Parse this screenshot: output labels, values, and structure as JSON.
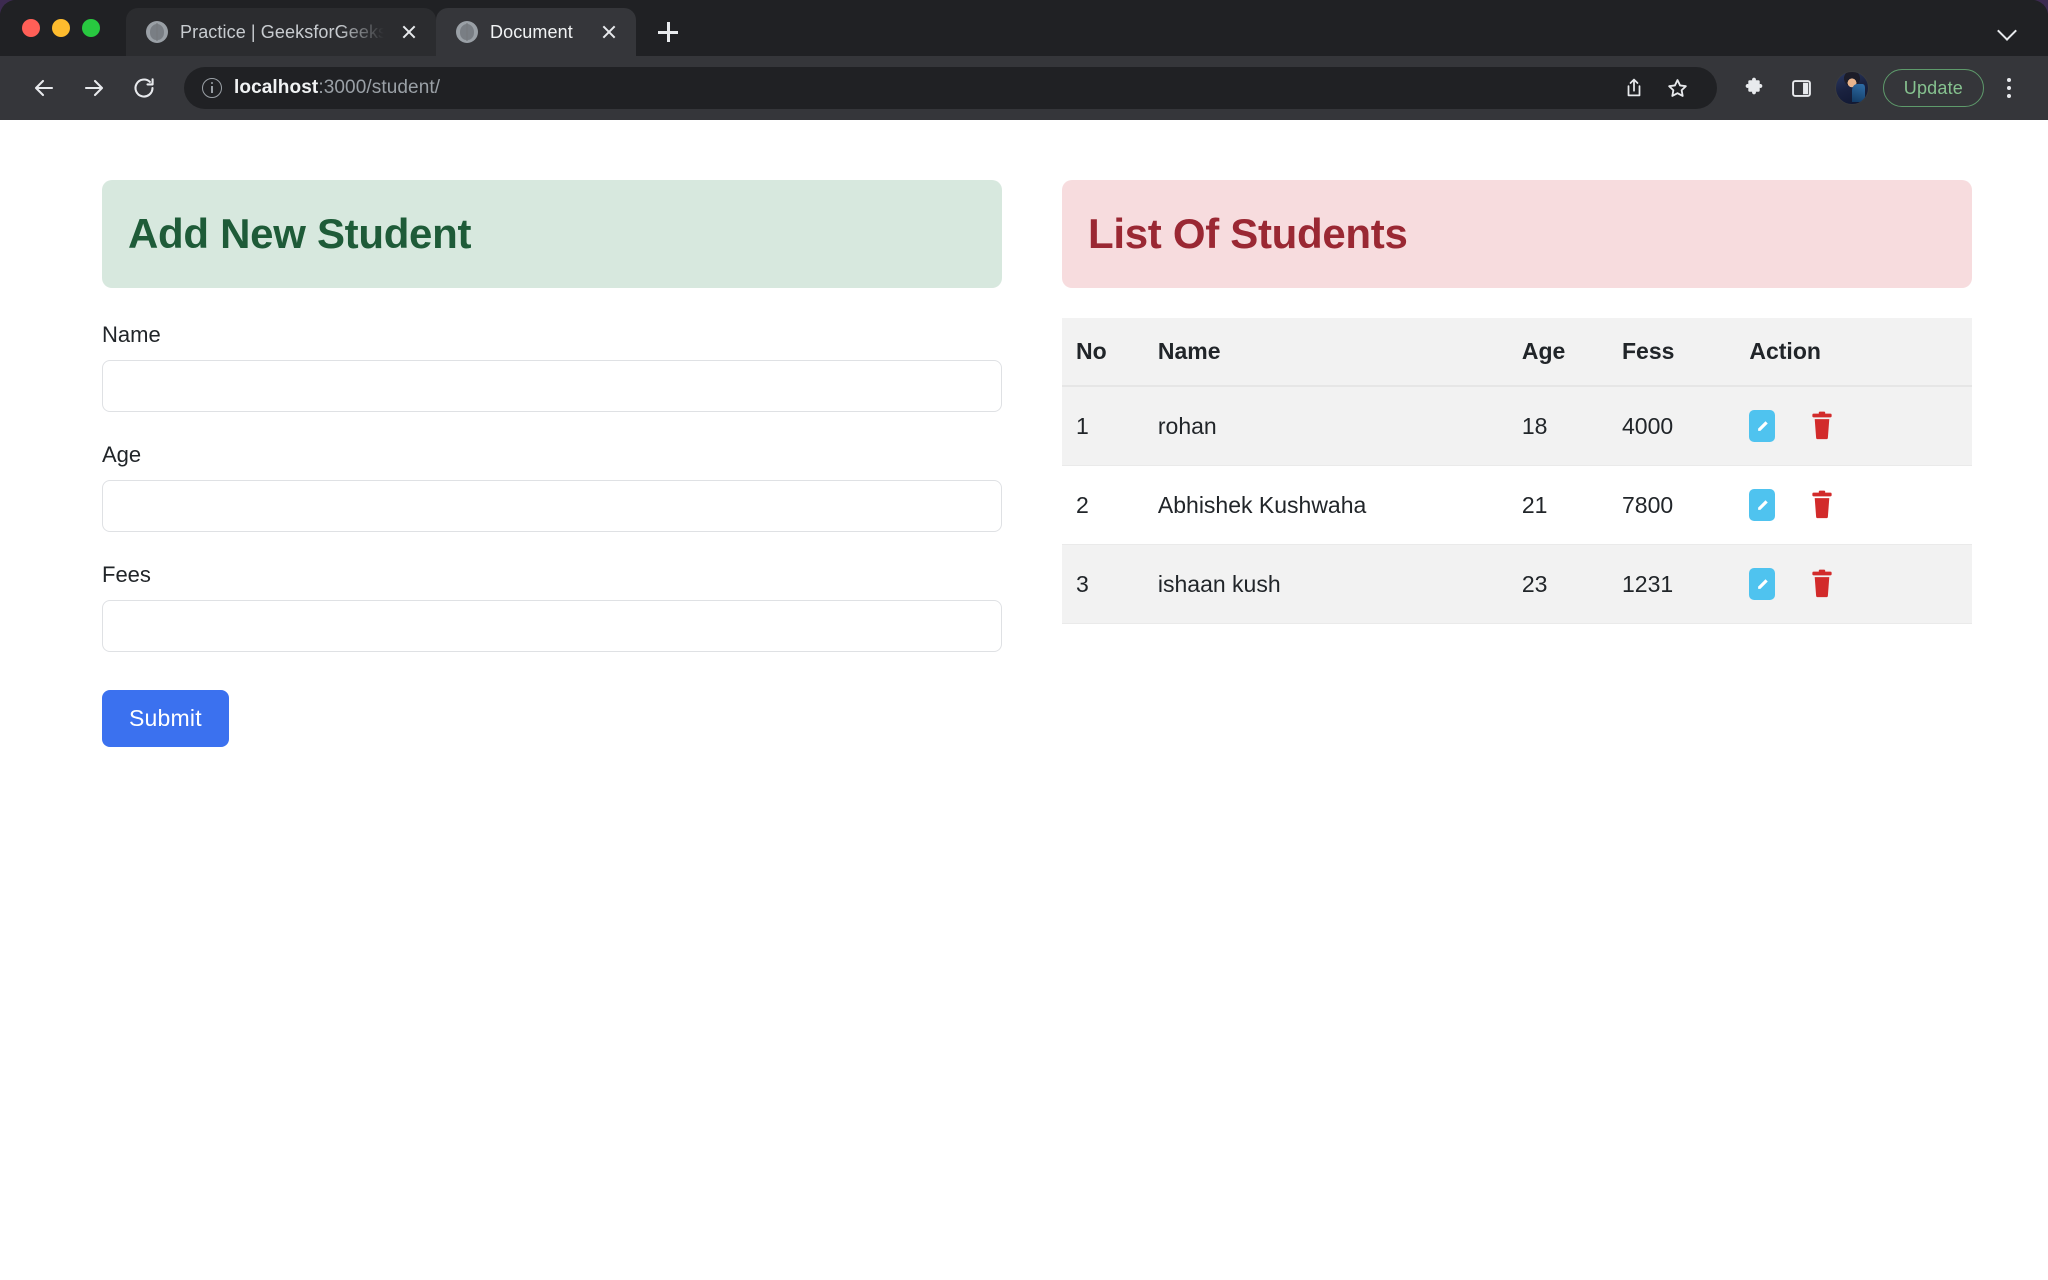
{
  "browser": {
    "tabs": [
      {
        "title": "Practice | GeeksforGeeks | A co",
        "active": false,
        "favicon": "globe-icon"
      },
      {
        "title": "Document",
        "active": true,
        "favicon": "globe-icon"
      }
    ],
    "omnibox": {
      "host": "localhost",
      "path": ":3000/student/",
      "security_icon": "info-circle-icon"
    },
    "toolbar": {
      "back_icon": "back-arrow-icon",
      "forward_icon": "forward-arrow-icon",
      "reload_icon": "reload-icon",
      "share_icon": "share-icon",
      "bookmark_icon": "star-icon",
      "extensions_icon": "puzzle-piece-icon",
      "sidepanel_icon": "side-panel-icon",
      "avatar_icon": "user-avatar",
      "update_label": "Update",
      "menu_icon": "kebab-menu-icon"
    },
    "new_tab_label": "+",
    "tab_list_icon": "chevron-down-icon",
    "window_controls": [
      "close",
      "minimize",
      "maximize"
    ]
  },
  "page": {
    "form_card": {
      "title": "Add New Student",
      "header_bg": "#d7e8de",
      "header_color": "#1e5b38",
      "fields": [
        {
          "label": "Name",
          "value": "",
          "placeholder": ""
        },
        {
          "label": "Age",
          "value": "",
          "placeholder": ""
        },
        {
          "label": "Fees",
          "value": "",
          "placeholder": ""
        }
      ],
      "submit_label": "Submit",
      "submit_color": "#3b71ef"
    },
    "list_card": {
      "title": "List Of Students",
      "header_bg": "#f7dcde",
      "header_color": "#9a2833",
      "table": {
        "columns": [
          "No",
          "Name",
          "Age",
          "Fess",
          "Action"
        ],
        "rows": [
          {
            "no": "1",
            "name": "rohan",
            "age": "18",
            "fees": "4000",
            "edit_icon": "pencil-icon",
            "delete_icon": "trash-icon"
          },
          {
            "no": "2",
            "name": "Abhishek Kushwaha",
            "age": "21",
            "fees": "7800",
            "edit_icon": "pencil-icon",
            "delete_icon": "trash-icon"
          },
          {
            "no": "3",
            "name": "ishaan kush",
            "age": "23",
            "fees": "1231",
            "edit_icon": "pencil-icon",
            "delete_icon": "trash-icon"
          }
        ],
        "edit_color": "#4fc3ef",
        "delete_color": "#d22b2b"
      }
    }
  }
}
